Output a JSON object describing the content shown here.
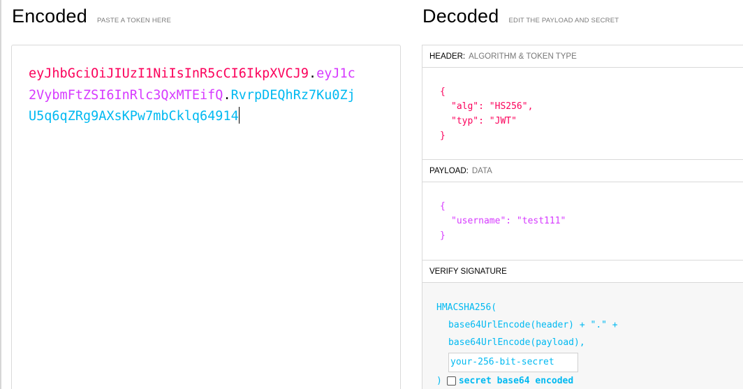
{
  "encoded": {
    "title": "Encoded",
    "subtitle": "PASTE A TOKEN HERE",
    "token": {
      "header": "eyJhbGciOiJIUzI1NiIsInR5cCI6IkpXVCJ9",
      "payload": "eyJ1c2VybmFtZSI6InRlc3QxMTEifQ",
      "signature": "RvrpDEQhRz7Ku0ZjU5q6qZRg9AXsKPw7mbCklq64914",
      "dot": "."
    }
  },
  "decoded": {
    "title": "Decoded",
    "subtitle": "EDIT THE PAYLOAD AND SECRET",
    "header_section": {
      "label": "HEADER:",
      "sublabel": "ALGORITHM & TOKEN TYPE",
      "open_brace": "{",
      "line_alg": "\"alg\": \"HS256\",",
      "line_typ": "\"typ\": \"JWT\"",
      "close_brace": "}"
    },
    "payload_section": {
      "label": "PAYLOAD:",
      "sublabel": "DATA",
      "open_brace": "{",
      "line_username": "\"username\": \"test111\"",
      "close_brace": "}"
    },
    "verify_section": {
      "label": "VERIFY SIGNATURE",
      "func_open": "HMACSHA256(",
      "line_header": "base64UrlEncode(header) + \".\" +",
      "line_payload": "base64UrlEncode(payload),",
      "secret_value": "your-256-bit-secret",
      "close_paren": ")",
      "base64_label": "secret base64 encoded",
      "base64_checked": false
    }
  },
  "colors": {
    "header": "#fb015b",
    "payload": "#d63aff",
    "signature": "#00b9f1"
  }
}
